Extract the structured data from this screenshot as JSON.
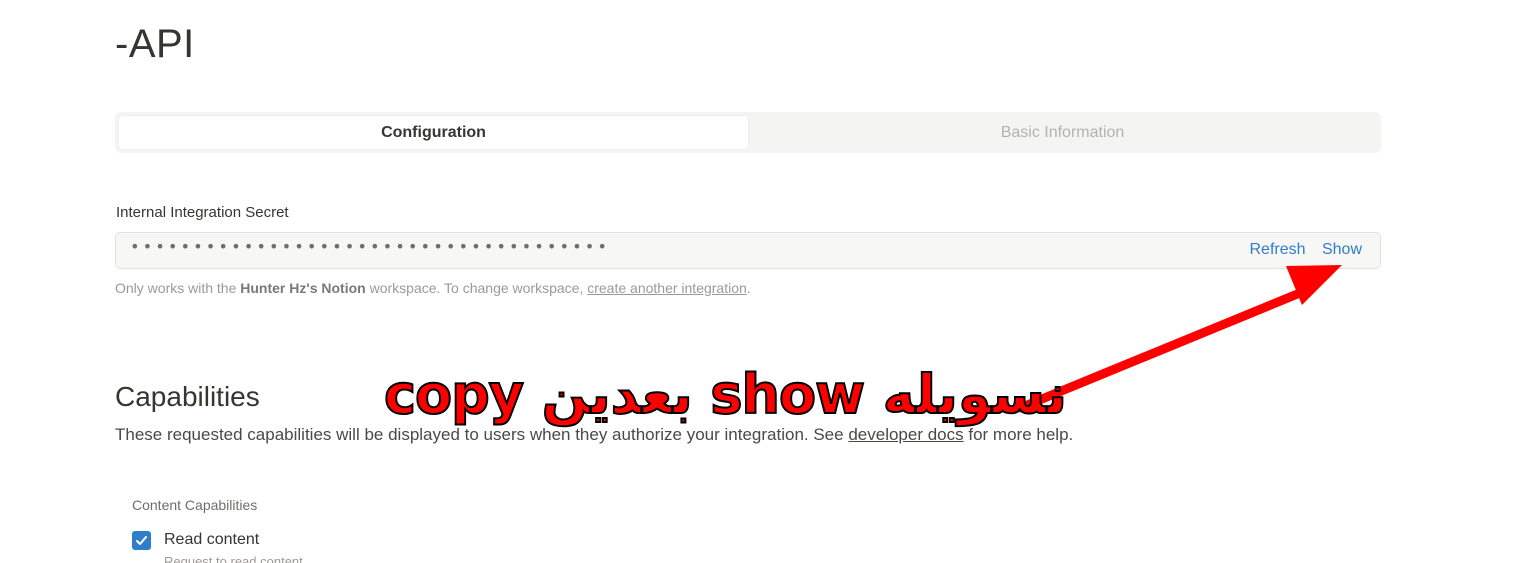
{
  "page": {
    "title": "-API"
  },
  "tabs": [
    {
      "label": "Configuration",
      "active": true
    },
    {
      "label": "Basic Information",
      "active": false
    }
  ],
  "secret": {
    "label": "Internal Integration Secret",
    "masked_value": "••••••••••••••••••••••••••••••••••••••",
    "refresh_label": "Refresh",
    "show_label": "Show"
  },
  "hint": {
    "prefix": "Only works with the ",
    "workspace": "Hunter Hz's Notion",
    "middle": " workspace. To change workspace, ",
    "link": "create another integration",
    "suffix": "."
  },
  "capabilities": {
    "heading": "Capabilities",
    "desc_prefix": "These requested capabilities will be displayed to users when they authorize your integration. See ",
    "desc_link": "developer docs",
    "desc_suffix": " for more help.",
    "section_label": "Content Capabilities",
    "items": [
      {
        "label": "Read content",
        "description": "Request to read content",
        "checked": true
      }
    ]
  },
  "annotation": {
    "text": "نسويله show بعدين copy",
    "color": "#ff0000",
    "outline_color": "#000000"
  },
  "colors": {
    "link": "#2f7ec9",
    "text": "#37352f",
    "muted": "#9b9a97"
  }
}
